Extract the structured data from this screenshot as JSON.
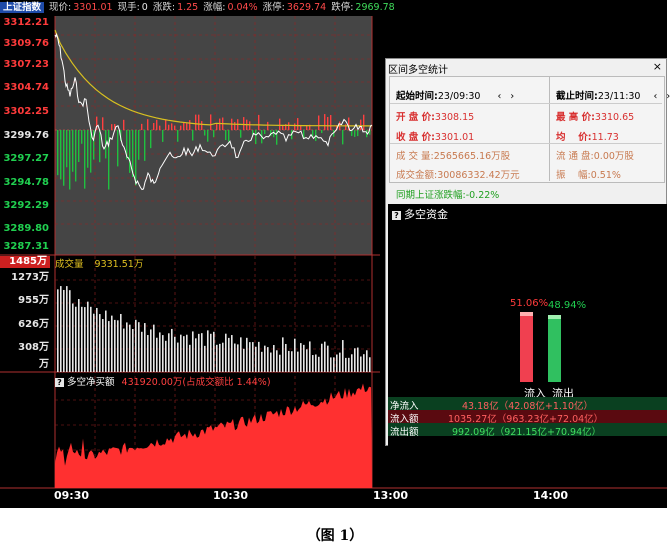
{
  "topbar": {
    "title": "上证指数",
    "items": [
      {
        "label": "现价:",
        "value": "3301.01"
      },
      {
        "label": "现手:",
        "value": "0"
      },
      {
        "label": "涨跌:",
        "value": "1.25"
      },
      {
        "label": "涨幅:",
        "value": "0.04%"
      },
      {
        "label": "涨停:",
        "value": "3629.74"
      },
      {
        "label": "跌停:",
        "value": "2969.78"
      }
    ]
  },
  "price_axis": [
    "3312.21",
    "3309.76",
    "3307.23",
    "3304.74",
    "3302.25",
    "3299.76",
    "3297.27",
    "3294.78",
    "3292.29",
    "3289.80",
    "3287.31"
  ],
  "volume_axis": [
    "1485万",
    "1273万",
    "955万",
    "626万",
    "308万",
    "万"
  ],
  "volume": {
    "label": "成交量",
    "value": "9331.51万"
  },
  "net_buy": {
    "label": "多空净买额",
    "value": "431920.00万(占成交额比 1.44%)"
  },
  "time_axis": [
    "09:30",
    "10:30",
    "13:00",
    "14:00"
  ],
  "caption": "（图 1）",
  "dialog": {
    "title": "区间多空统计",
    "start": {
      "label": "起始时间:",
      "value": "23/09:30"
    },
    "end": {
      "label": "截止时间:",
      "value": "23/11:30"
    },
    "open": {
      "label": "开 盘 价:",
      "value": "3308.15"
    },
    "high": {
      "label": "最 高 价:",
      "value": "3310.65"
    },
    "close": {
      "label": "收 盘 价:",
      "value": "3301.01"
    },
    "avg": {
      "label": "均　 价:",
      "value": "11.73"
    },
    "vol": {
      "label": "成 交 量:",
      "value": "2565665.16万股"
    },
    "float": {
      "label": "流 通 盘:",
      "value": "0.00万股"
    },
    "amount": {
      "label": "成交金额:",
      "value": "30086332.42万元"
    },
    "swing": {
      "label": "振　 幅:",
      "value": "0.51%"
    },
    "period_change": {
      "label": "同期上证涨跌幅:",
      "value": "-0.22%"
    },
    "flow_title": "多空资金",
    "inflow_pct": "51.06%",
    "outflow_pct": "48.94%",
    "inflow_label": "流入",
    "outflow_label": "流出",
    "net_in": {
      "label": "净流入",
      "value": "43.18亿（42.08亿+1.10亿）"
    },
    "in_amt": {
      "label": "流入额",
      "value": "1035.27亿（963.23亿+72.04亿）"
    },
    "out_amt": {
      "label": "流出额",
      "value": "992.09亿（921.15亿+70.94亿）"
    }
  },
  "colors": {
    "up": "#ff3b3b",
    "down": "#20d050",
    "price_line": "#ffffff",
    "avg_line": "#e0c020"
  }
}
